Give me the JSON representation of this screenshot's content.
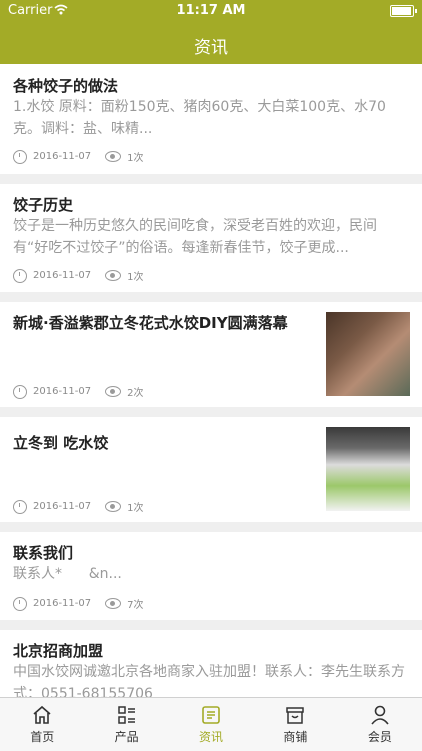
{
  "status": {
    "carrier": "Carrier",
    "time": "11:17 AM"
  },
  "nav": {
    "title": "资讯"
  },
  "articles": [
    {
      "title": "各种饺子的做法",
      "summary": "1.水饺 原料：面粉150克、猪肉60克、大白菜100克、水70克。调料：盐、味精...",
      "date": "2016-11-07",
      "views": "1次",
      "has_image": false
    },
    {
      "title": "饺子历史",
      "summary": "饺子是一种历史悠久的民间吃食，深受老百姓的欢迎，民间有“好吃不过饺子”的俗语。每逢新春佳节，饺子更成...",
      "date": "2016-11-07",
      "views": "1次",
      "has_image": false
    },
    {
      "title": "新城·香溢紫郡立冬花式水饺DIY圆满落幕",
      "summary": "",
      "date": "2016-11-07",
      "views": "2次",
      "has_image": true
    },
    {
      "title": "立冬到 吃水饺",
      "summary": "",
      "date": "2016-11-07",
      "views": "1次",
      "has_image": true
    },
    {
      "title": "联系我们",
      "summary": "联系人*      &n...",
      "date": "2016-11-07",
      "views": "7次",
      "has_image": false
    },
    {
      "title": "北京招商加盟",
      "summary": "中国水饺网诚邀北京各地商家入驻加盟！联系人：李先生联系方式：0551-68155706",
      "date": "",
      "views": "",
      "has_image": false
    }
  ],
  "tabs": [
    {
      "label": "首页",
      "icon": "home-icon",
      "active": false
    },
    {
      "label": "产品",
      "icon": "list-icon",
      "active": false
    },
    {
      "label": "资讯",
      "icon": "news-icon",
      "active": true
    },
    {
      "label": "商铺",
      "icon": "shop-icon",
      "active": false
    },
    {
      "label": "会员",
      "icon": "user-icon",
      "active": false
    }
  ],
  "colors": {
    "accent": "#a3ab27",
    "background": "#efefef"
  }
}
